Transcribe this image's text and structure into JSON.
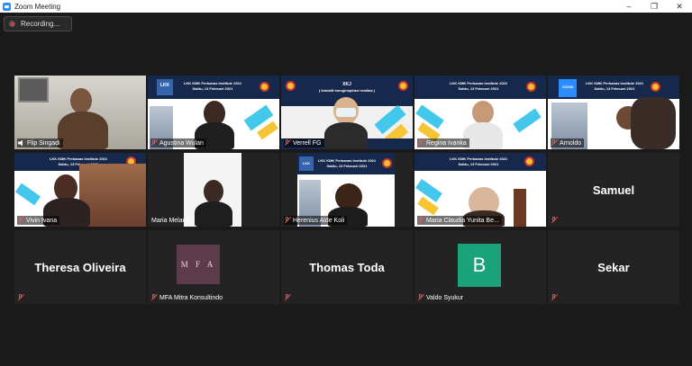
{
  "window": {
    "title": "Zoom Meeting",
    "controls": [
      "–",
      "❐",
      "✕"
    ]
  },
  "recording": {
    "label": "Recording..."
  },
  "slides": {
    "event_title": "LKK KMK Perbanas Institute 2021",
    "event_date": "Sabtu, 13 Februari 2021",
    "badge_lkk": "LKK",
    "badge_zoom": "ZOOM",
    "xkj_title": "XKJ",
    "xkj_subtitle": "( Inisiatif menginspirasi realitas )"
  },
  "mfa": {
    "logo_text": "M F A"
  },
  "avatar": {
    "letter": "B"
  },
  "participants": [
    {
      "name": "Flip Singadi",
      "type": "video",
      "active": true
    },
    {
      "name": "Agustina Wulan",
      "type": "video"
    },
    {
      "name": "Verrell FG",
      "type": "video"
    },
    {
      "name": "Regina Ivanka",
      "type": "video"
    },
    {
      "name": "Arnoldo",
      "type": "video"
    },
    {
      "name": "Vivin Ivana",
      "type": "video"
    },
    {
      "name": "Maria Melania",
      "type": "video"
    },
    {
      "name": "Herenius Alde Koli",
      "type": "video"
    },
    {
      "name": "Maria Claudia Yunita Be...",
      "type": "video"
    },
    {
      "name": "Samuel",
      "type": "name-only"
    },
    {
      "name": "Theresa Oliveira",
      "type": "name-only"
    },
    {
      "name": "MFA Mitra Konsultindo",
      "type": "logo"
    },
    {
      "name": "Thomas Toda",
      "type": "name-only"
    },
    {
      "name": "Valdo Syukur",
      "type": "avatar"
    },
    {
      "name": "Sekar",
      "type": "name-only"
    }
  ],
  "colors": {
    "active_speaker": "#9be63a",
    "muted": "#ff4d4d",
    "tile_bg": "#232323",
    "avatar_bg": "#1aa37a",
    "mfa_bg": "#5e3b4a"
  }
}
